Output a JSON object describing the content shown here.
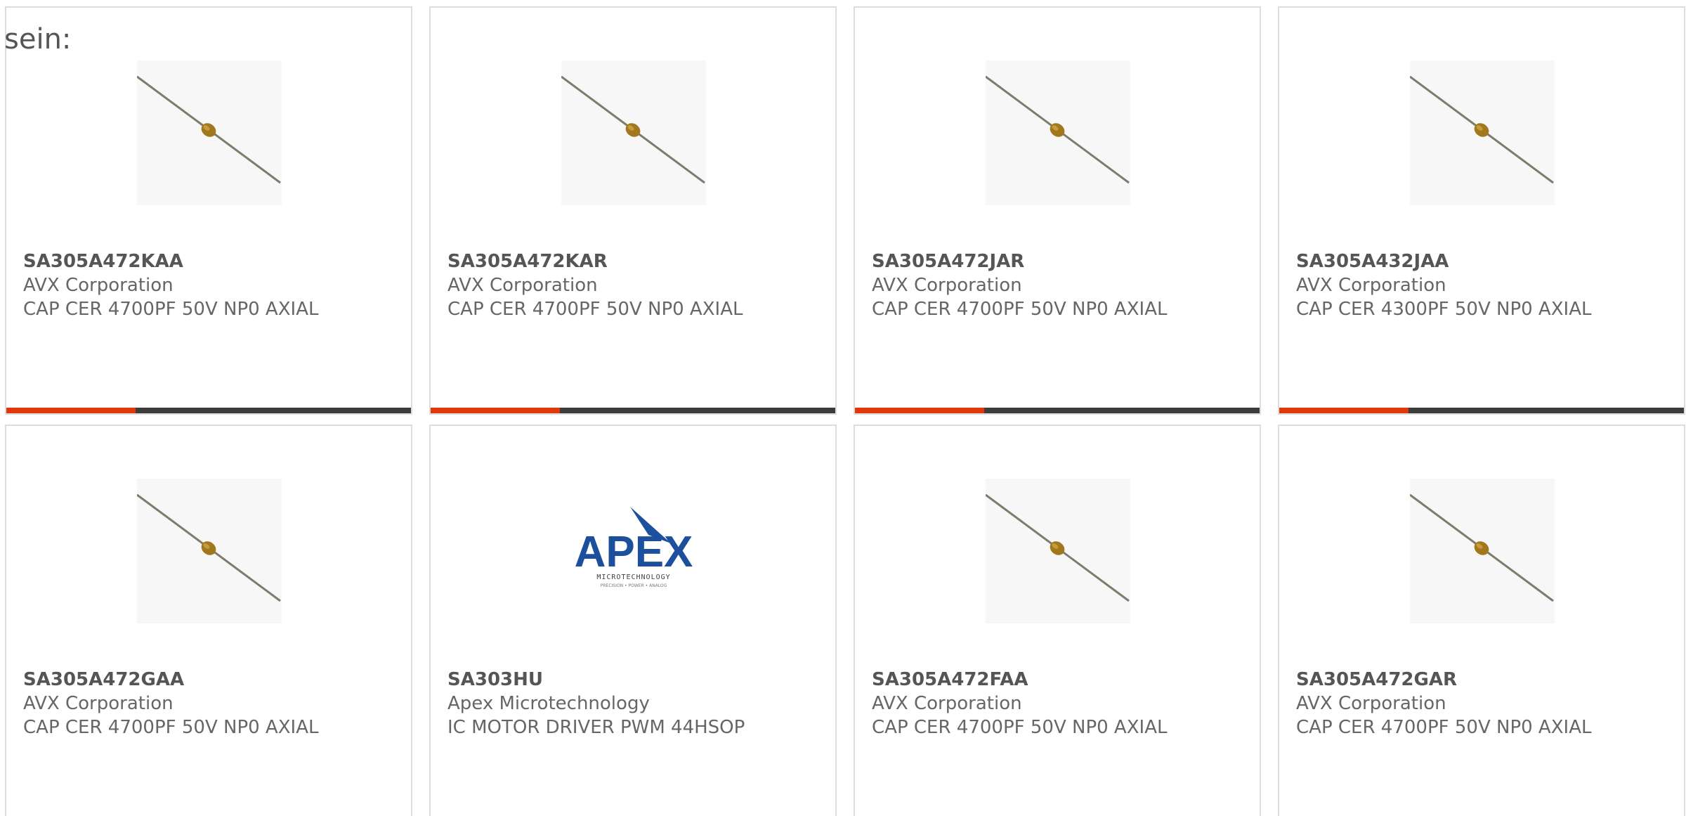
{
  "intro_text": "sein:",
  "colors": {
    "accent": "#e0380b",
    "bar": "#3c3c3c",
    "border": "#dddddd",
    "text": "#666666",
    "apex_blue": "#1c4f9c"
  },
  "products": [
    {
      "part": "SA305A472KAA",
      "maker": "AVX Corporation",
      "desc": "CAP CER 4700PF 50V NP0 AXIAL",
      "image": "axial-capacitor-image",
      "accent_bar": true
    },
    {
      "part": "SA305A472KAR",
      "maker": "AVX Corporation",
      "desc": "CAP CER 4700PF 50V NP0 AXIAL",
      "image": "axial-capacitor-image",
      "accent_bar": true
    },
    {
      "part": "SA305A472JAR",
      "maker": "AVX Corporation",
      "desc": "CAP CER 4700PF 50V NP0 AXIAL",
      "image": "axial-capacitor-image",
      "accent_bar": true
    },
    {
      "part": "SA305A432JAA",
      "maker": "AVX Corporation",
      "desc": "CAP CER 4300PF 50V NP0 AXIAL",
      "image": "axial-capacitor-image",
      "accent_bar": true
    },
    {
      "part": "SA305A472GAA",
      "maker": "AVX Corporation",
      "desc": "CAP CER 4700PF 50V NP0 AXIAL",
      "image": "axial-capacitor-image",
      "accent_bar": false
    },
    {
      "part": "SA303HU",
      "maker": "Apex Microtechnology",
      "desc": "IC MOTOR DRIVER PWM 44HSOP",
      "image": "apex-logo",
      "logo_text": "APEX",
      "logo_sub": "MICROTECHNOLOGY",
      "logo_tagline": "PRECISION • POWER • ANALOG",
      "accent_bar": false
    },
    {
      "part": "SA305A472FAA",
      "maker": "AVX Corporation",
      "desc": "CAP CER 4700PF 50V NP0 AXIAL",
      "image": "axial-capacitor-image",
      "accent_bar": false
    },
    {
      "part": "SA305A472GAR",
      "maker": "AVX Corporation",
      "desc": "CAP CER 4700PF 50V NP0 AXIAL",
      "image": "axial-capacitor-image",
      "accent_bar": false
    }
  ]
}
